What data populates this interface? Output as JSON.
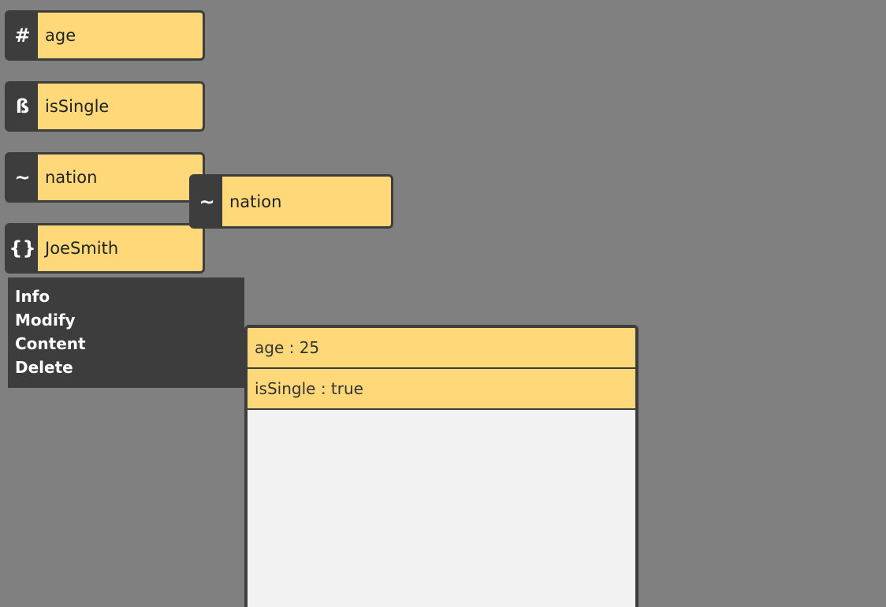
{
  "variables": [
    {
      "icon": "#",
      "icon_name": "hash-icon",
      "name": "age"
    },
    {
      "icon": "ß",
      "icon_name": "beta-icon",
      "name": "isSingle"
    },
    {
      "icon": "~",
      "icon_name": "tilde-icon",
      "name": "nation"
    },
    {
      "icon": "{}",
      "icon_name": "braces-icon",
      "name": "JoeSmith"
    }
  ],
  "dragged_block": {
    "icon": "~",
    "icon_name": "tilde-icon",
    "name": "nation"
  },
  "context_menu": {
    "items": [
      "Info",
      "Modify",
      "Content",
      "Delete"
    ]
  },
  "content_panel": {
    "rows": [
      "age : 25",
      "isSingle : true"
    ]
  },
  "colors": {
    "background": "#808080",
    "block_dark": "#3d3d3d",
    "block_fill": "#ffd87a",
    "panel_bg": "#f2f2f2"
  }
}
